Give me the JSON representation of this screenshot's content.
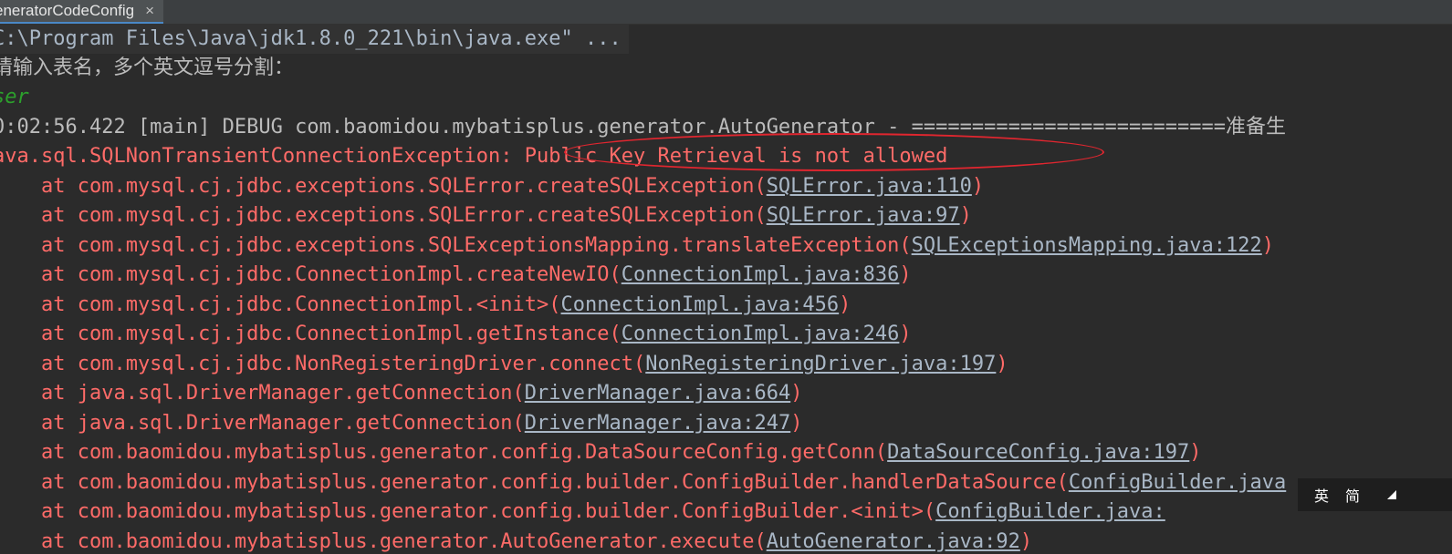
{
  "tab": {
    "label": "eneratorCodeConfig",
    "close_glyph": "×"
  },
  "console": {
    "command": "C:\\Program Files\\Java\\jdk1.8.0_221\\bin\\java.exe\" ...",
    "prompt": "请输入表名，多个英文逗号分割：",
    "user_input": "ser",
    "debug_line": "0:02:56.422 [main] DEBUG com.baomidou.mybatisplus.generator.AutoGenerator - ==========================准备生",
    "exception_class": "ava.sql.SQLNonTransientConnectionException:",
    "exception_message": " Public Key Retrieval is not allowed",
    "stack": [
      {
        "prefix": "    at com.mysql.cj.jdbc.exceptions.SQLError.createSQLException(",
        "link": "SQLError.java:110",
        "suffix": ")"
      },
      {
        "prefix": "    at com.mysql.cj.jdbc.exceptions.SQLError.createSQLException(",
        "link": "SQLError.java:97",
        "suffix": ")"
      },
      {
        "prefix": "    at com.mysql.cj.jdbc.exceptions.SQLExceptionsMapping.translateException(",
        "link": "SQLExceptionsMapping.java:122",
        "suffix": ")"
      },
      {
        "prefix": "    at com.mysql.cj.jdbc.ConnectionImpl.createNewIO(",
        "link": "ConnectionImpl.java:836",
        "suffix": ")"
      },
      {
        "prefix": "    at com.mysql.cj.jdbc.ConnectionImpl.<init>(",
        "link": "ConnectionImpl.java:456",
        "suffix": ")"
      },
      {
        "prefix": "    at com.mysql.cj.jdbc.ConnectionImpl.getInstance(",
        "link": "ConnectionImpl.java:246",
        "suffix": ")"
      },
      {
        "prefix": "    at com.mysql.cj.jdbc.NonRegisteringDriver.connect(",
        "link": "NonRegisteringDriver.java:197",
        "suffix": ")"
      },
      {
        "prefix": "    at java.sql.DriverManager.getConnection(",
        "link": "DriverManager.java:664",
        "suffix": ")"
      },
      {
        "prefix": "    at java.sql.DriverManager.getConnection(",
        "link": "DriverManager.java:247",
        "suffix": ")"
      },
      {
        "prefix": "    at com.baomidou.mybatisplus.generator.config.DataSourceConfig.getConn(",
        "link": "DataSourceConfig.java:197",
        "suffix": ")"
      },
      {
        "prefix": "    at com.baomidou.mybatisplus.generator.config.builder.ConfigBuilder.handlerDataSource(",
        "link": "ConfigBuilder.java",
        "suffix": ""
      },
      {
        "prefix": "    at com.baomidou.mybatisplus.generator.config.builder.ConfigBuilder.<init>(",
        "link": "ConfigBuilder.java:",
        "suffix": ""
      },
      {
        "prefix": "    at com.baomidou.mybatisplus.generator.AutoGenerator.execute(",
        "link": "AutoGenerator.java:92",
        "suffix": ")"
      }
    ]
  },
  "ime": {
    "mode1": "英",
    "mode2": "简"
  }
}
